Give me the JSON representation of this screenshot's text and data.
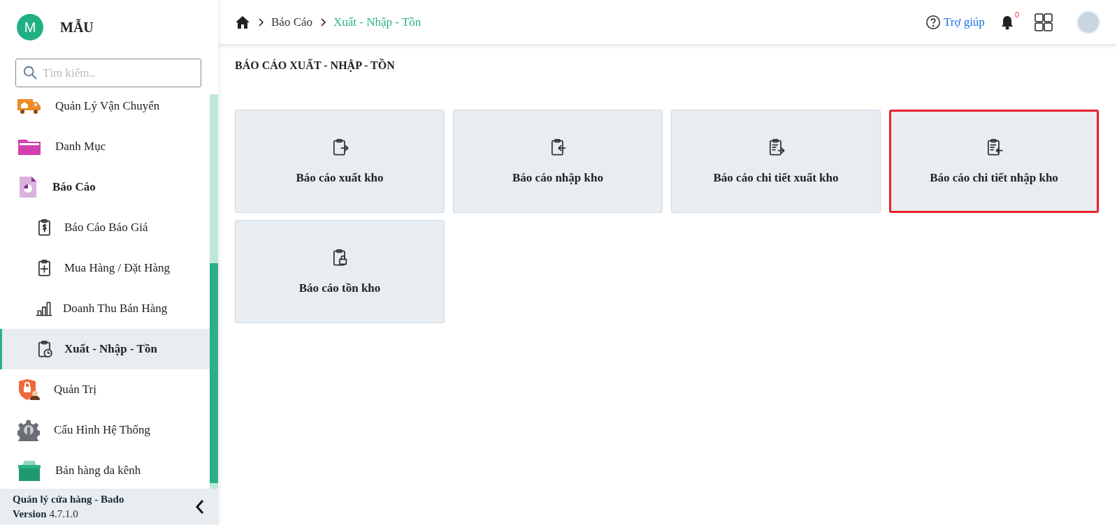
{
  "brand": {
    "letter": "M",
    "name": "MẪU"
  },
  "search": {
    "placeholder": "Tìm kiếm.."
  },
  "menu": [
    {
      "label": "Quản Lý Vận Chuyển",
      "selected": false
    },
    {
      "label": "Danh Mục",
      "selected": false
    },
    {
      "label": "Báo Cáo",
      "selected": false,
      "expanded": true,
      "children": [
        {
          "label": "Báo Cáo Báo Giá",
          "selected": false
        },
        {
          "label": "Mua Hàng / Đặt Hàng",
          "selected": false
        },
        {
          "label": "Doanh Thu Bán Hàng",
          "selected": false
        },
        {
          "label": "Xuất - Nhập - Tồn",
          "selected": true
        }
      ]
    },
    {
      "label": "Quản Trị",
      "selected": false
    },
    {
      "label": "Cấu Hình Hệ Thống",
      "selected": false
    },
    {
      "label": "Bán hàng đa kênh",
      "selected": false
    }
  ],
  "footer": {
    "app": "Quản lý cửa hàng - Bado",
    "version_label": "Version",
    "version": "4.7.1.0"
  },
  "breadcrumb": [
    "Báo Cáo",
    "Xuất - Nhập - Tồn"
  ],
  "header": {
    "help": "Trợ giúp",
    "notifications": "0"
  },
  "page_title": "BÁO CÁO XUẤT - NHẬP - TỒN",
  "cards": [
    {
      "label": "Báo cáo xuất kho",
      "highlighted": false
    },
    {
      "label": "Báo cáo nhập kho",
      "highlighted": false
    },
    {
      "label": "Báo cáo chi tiết xuất kho",
      "highlighted": false
    },
    {
      "label": "Báo cáo chi tiết nhập kho",
      "highlighted": true
    },
    {
      "label": "Báo cáo tồn kho",
      "highlighted": false
    }
  ]
}
